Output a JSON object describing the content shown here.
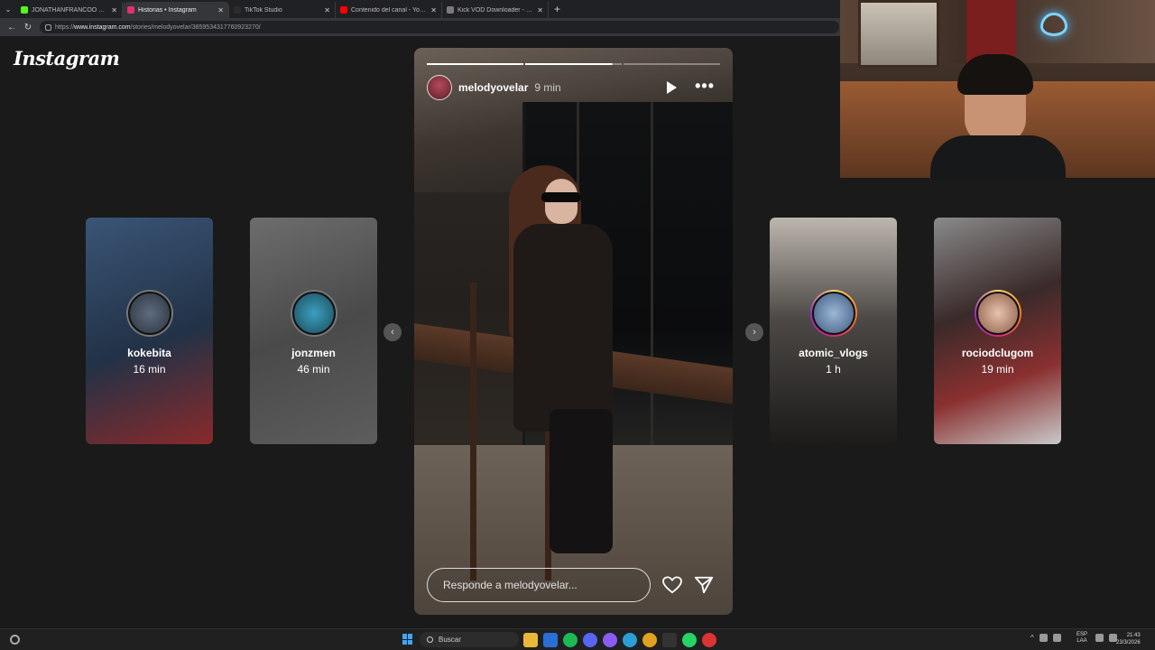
{
  "browser": {
    "tabs": [
      {
        "title": "JONATHANFRANCOO Stream - W",
        "fav_color": "#53fc18",
        "active": false
      },
      {
        "title": "Historias • Instagram",
        "fav_color": "#e1306c",
        "active": true
      },
      {
        "title": "TikTok Studio",
        "fav_color": "#2b2b2b",
        "active": false
      },
      {
        "title": "Contenido del canal - YouTube St",
        "fav_color": "#ff0000",
        "active": false
      },
      {
        "title": "Kick VOD Downloader - Stream V",
        "fav_color": "#7a7a7a",
        "active": false
      }
    ],
    "address": {
      "prefix": "https://",
      "host": "www.instagram.com",
      "path": "/stories/melodyovelar/3859534317760923270/"
    }
  },
  "instagram": {
    "logo": "Instagram",
    "main_story": {
      "username": "melodyovelar",
      "time": "9 min",
      "reply_placeholder": "Responde a melodyovelar...",
      "progress": [
        1,
        0.9,
        0
      ]
    },
    "side_stories": [
      {
        "username": "kokebita",
        "time": "16 min",
        "bg": "#2f4a6a",
        "ring": "#777777",
        "avatar": "#3b4a5c"
      },
      {
        "username": "jonzmen",
        "time": "46 min",
        "bg": "#5a5a5a",
        "ring": "#777777",
        "avatar": "#2a6f86"
      },
      {
        "username": "atomic_vlogs",
        "time": "1 h",
        "bg": "#4b4845",
        "ring": "#e1306c",
        "avatar": "#6d8bb0"
      },
      {
        "username": "rociodclugom",
        "time": "19 min",
        "bg": "#6a4a4a",
        "ring": "#e1306c",
        "avatar": "#d9a88f"
      }
    ]
  },
  "taskbar": {
    "search_label": "Buscar",
    "lang": [
      "ESP",
      "LAA"
    ],
    "time": "21:43",
    "date": "23/3/2026"
  }
}
